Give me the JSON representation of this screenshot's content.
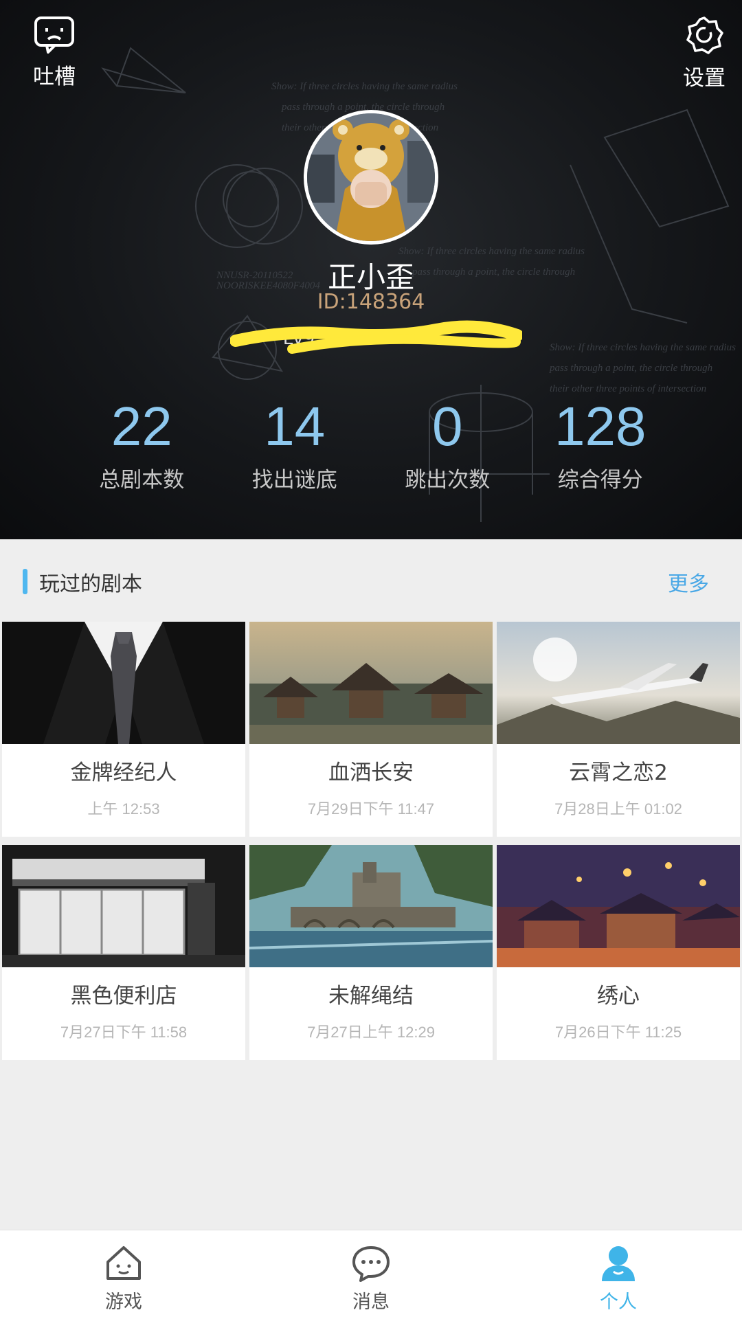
{
  "header": {
    "complain_label": "吐槽",
    "settings_label": "设置",
    "username": "正小歪",
    "user_id": "ID:148364",
    "level_text": "Lv9"
  },
  "stats": [
    {
      "value": "22",
      "label": "总剧本数"
    },
    {
      "value": "14",
      "label": "找出谜底"
    },
    {
      "value": "0",
      "label": "跳出次数"
    },
    {
      "value": "128",
      "label": "综合得分"
    }
  ],
  "section": {
    "title": "玩过的剧本",
    "more_label": "更多"
  },
  "scripts": [
    {
      "title": "金牌经纪人",
      "time": "上午 12:53",
      "image": "suit-tie-image"
    },
    {
      "title": "血洒长安",
      "time": "7月29日下午 11:47",
      "image": "ancient-city-image"
    },
    {
      "title": "云霄之恋2",
      "time": "7月28日上午 01:02",
      "image": "airplane-image"
    },
    {
      "title": "黑色便利店",
      "time": "7月27日下午 11:58",
      "image": "convenience-store-image"
    },
    {
      "title": "未解绳结",
      "time": "7月27日上午 12:29",
      "image": "castle-river-image"
    },
    {
      "title": "绣心",
      "time": "7月26日下午 11:25",
      "image": "lantern-palace-image"
    }
  ],
  "nav": [
    {
      "label": "游戏",
      "icon": "house-icon",
      "active": false
    },
    {
      "label": "消息",
      "icon": "chat-bubble-icon",
      "active": false
    },
    {
      "label": "个人",
      "icon": "person-icon",
      "active": true
    }
  ],
  "colors": {
    "accent": "#3fb4e8",
    "stat_number": "#8ec8ee",
    "user_id": "#c9a37a",
    "redaction": "#ffe93b"
  }
}
